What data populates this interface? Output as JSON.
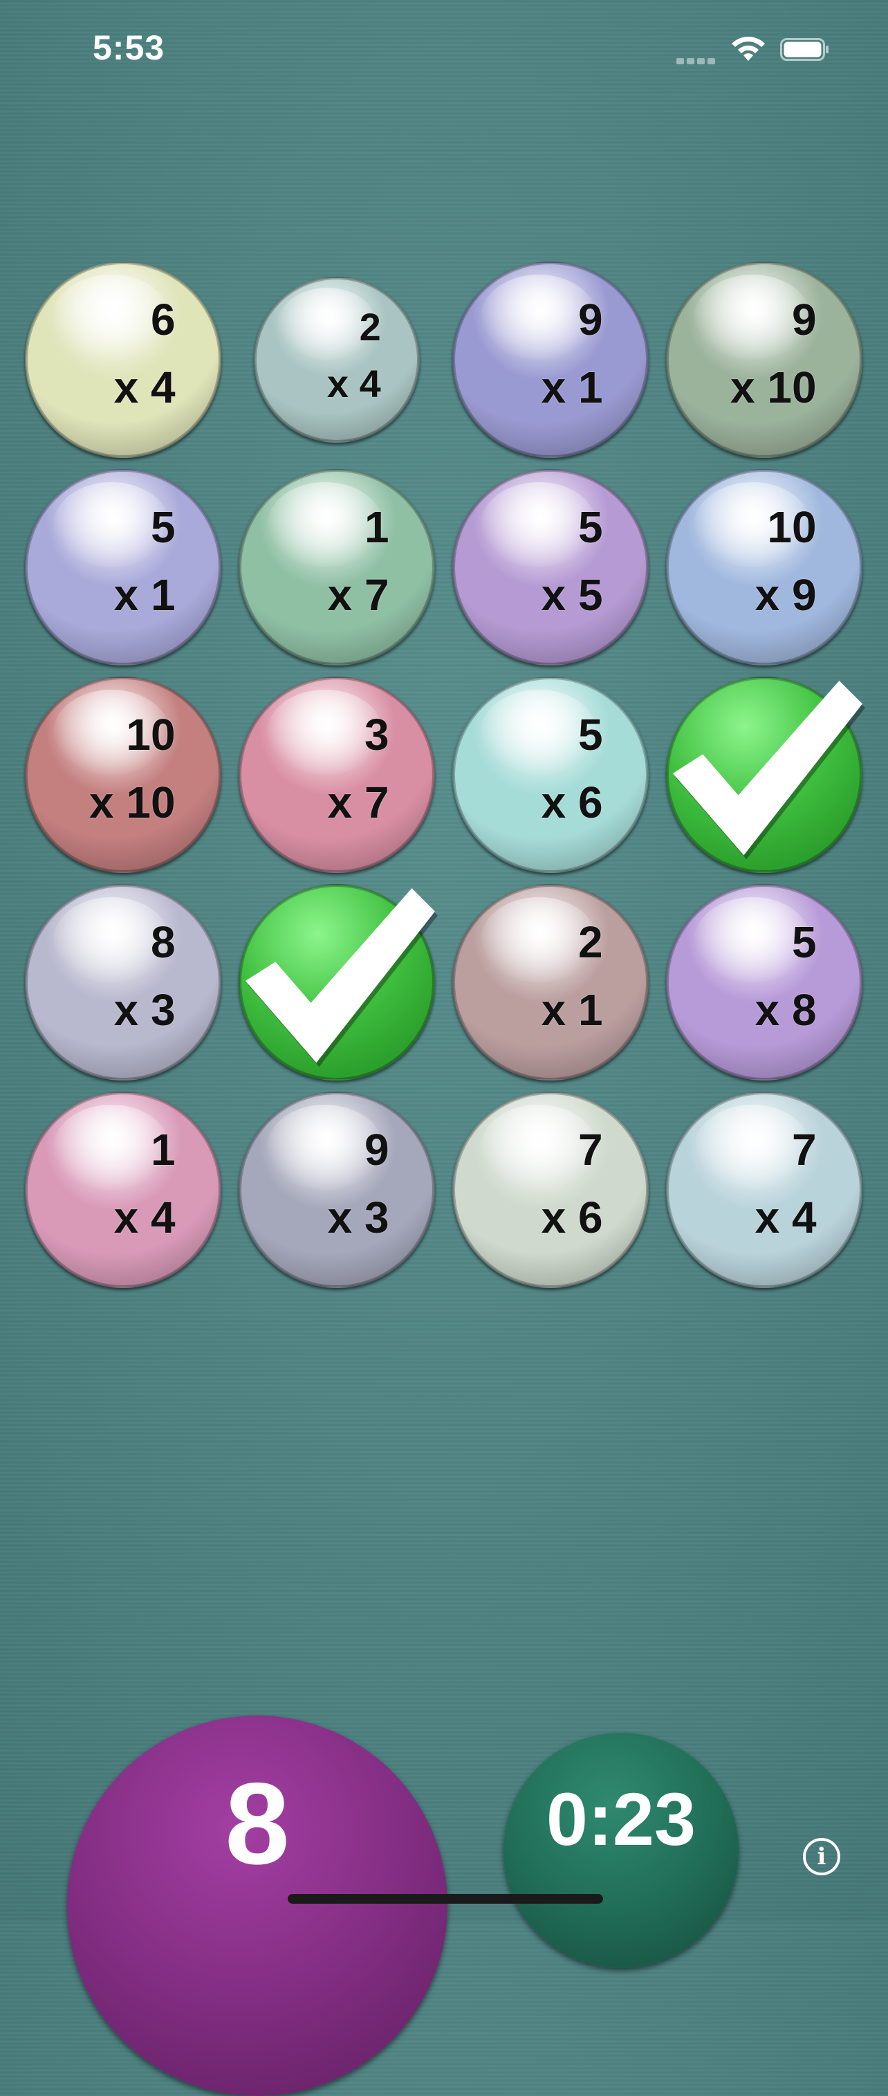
{
  "status_bar": {
    "time": "5:53"
  },
  "colors": {
    "correct": "#3fbf3f",
    "score": "#862f86",
    "timer": "#216e57"
  },
  "cards": [
    {
      "top": "6",
      "bottom": "x 4",
      "color": "#dfe4b9",
      "state": "open",
      "size": "large"
    },
    {
      "top": "2",
      "bottom": "x 4",
      "color": "#a9c4c2",
      "state": "open",
      "size": "small"
    },
    {
      "top": "9",
      "bottom": "x 1",
      "color": "#9a9ad2",
      "state": "open",
      "size": "large"
    },
    {
      "top": "9",
      "bottom": "x 10",
      "color": "#9bb29b",
      "state": "open",
      "size": "large"
    },
    {
      "top": "5",
      "bottom": "x 1",
      "color": "#a9a9da",
      "state": "open",
      "size": "large"
    },
    {
      "top": "1",
      "bottom": "x 7",
      "color": "#8fc0a4",
      "state": "open",
      "size": "large"
    },
    {
      "top": "5",
      "bottom": "x 5",
      "color": "#b59ad3",
      "state": "open",
      "size": "large"
    },
    {
      "top": "10",
      "bottom": "x 9",
      "color": "#a0b8de",
      "state": "open",
      "size": "large"
    },
    {
      "top": "10",
      "bottom": "x 10",
      "color": "#c47f7f",
      "state": "open",
      "size": "large"
    },
    {
      "top": "3",
      "bottom": "x 7",
      "color": "#d98fa3",
      "state": "open",
      "size": "large"
    },
    {
      "top": "5",
      "bottom": "x 6",
      "color": "#a6dcd8",
      "state": "open",
      "size": "large"
    },
    {
      "top": "",
      "bottom": "",
      "color": "#3fbf3f",
      "state": "correct",
      "size": "large"
    },
    {
      "top": "8",
      "bottom": "x 3",
      "color": "#b8b8ce",
      "state": "open",
      "size": "large"
    },
    {
      "top": "",
      "bottom": "",
      "color": "#3fbf3f",
      "state": "correct",
      "size": "large"
    },
    {
      "top": "2",
      "bottom": "x 1",
      "color": "#bb9f9f",
      "state": "open",
      "size": "large"
    },
    {
      "top": "5",
      "bottom": "x 8",
      "color": "#b79ad8",
      "state": "open",
      "size": "large"
    },
    {
      "top": "1",
      "bottom": "x 4",
      "color": "#d99ab8",
      "state": "open",
      "size": "large"
    },
    {
      "top": "9",
      "bottom": "x 3",
      "color": "#a5a8bb",
      "state": "open",
      "size": "large"
    },
    {
      "top": "7",
      "bottom": "x 6",
      "color": "#cfd9cd",
      "state": "open",
      "size": "large"
    },
    {
      "top": "7",
      "bottom": "x 4",
      "color": "#b9d3da",
      "state": "open",
      "size": "large"
    }
  ],
  "score": {
    "value": "8"
  },
  "timer": {
    "value": "0:23"
  },
  "info_button": {
    "glyph": "i"
  }
}
